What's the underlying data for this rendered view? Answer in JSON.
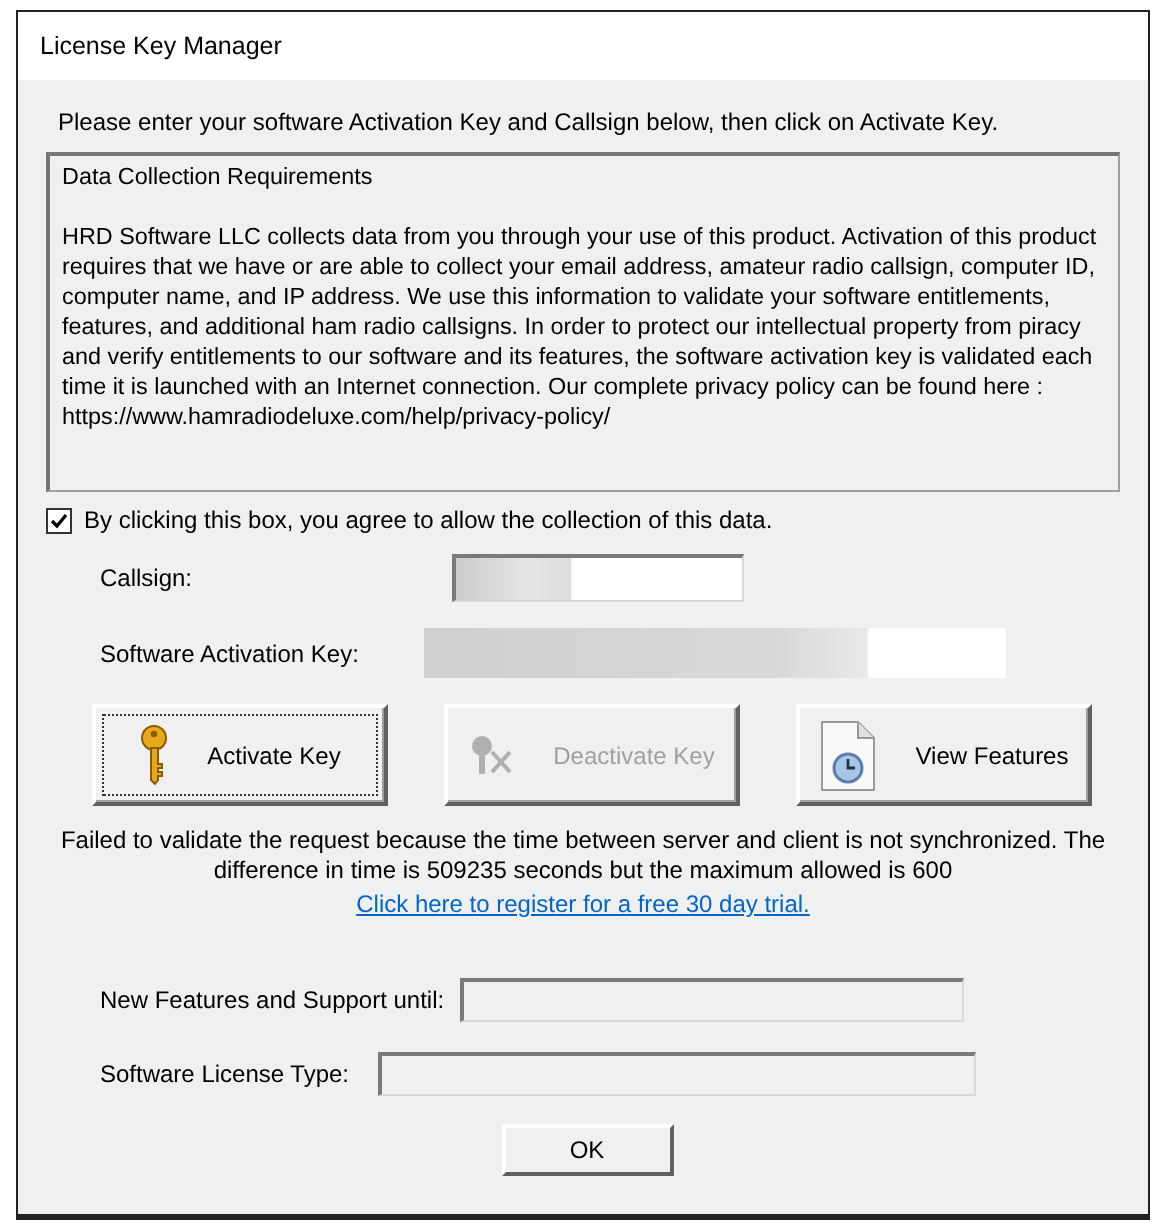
{
  "window": {
    "title": "License Key Manager"
  },
  "instruction": "Please enter your software Activation Key and Callsign below, then click on Activate Key.",
  "notice": {
    "heading": "Data Collection Requirements",
    "body": "HRD Software LLC collects data from you through your use of this product. Activation of this product requires that we have or are able to collect your email address, amateur radio callsign, computer ID, computer name, and IP address. We use this information to validate your software entitlements, features, and additional ham radio callsigns. In order to protect our intellectual property from piracy and verify entitlements to our software and its features, the software activation key is validated each time it is launched with an Internet connection. Our complete privacy policy can be found here :",
    "url": "https://www.hamradiodeluxe.com/help/privacy-policy/"
  },
  "consent": {
    "label": "By clicking this box, you agree to allow the collection of this data.",
    "checked": true
  },
  "callsign": {
    "label": "Callsign:",
    "redacted": true
  },
  "activation_key": {
    "label": "Software Activation Key:",
    "redacted": true
  },
  "buttons": [
    {
      "kind": "key",
      "label": "Activate Key",
      "disabled": false,
      "focused": true
    },
    {
      "kind": "unkey",
      "label": "Deactivate Key",
      "disabled": true,
      "focused": false
    },
    {
      "kind": "features",
      "label": "View Features",
      "disabled": false,
      "focused": false
    }
  ],
  "error": "Failed to validate the request because the time between server and client is not synchronized. The difference in time is 509235 seconds but the maximum allowed is 600",
  "trial_link": "Click here to register for a free 30 day trial.",
  "support_until": {
    "label": "New Features and Support until:"
  },
  "license_type": {
    "label": "Software License Type:"
  },
  "ok_button": "OK"
}
